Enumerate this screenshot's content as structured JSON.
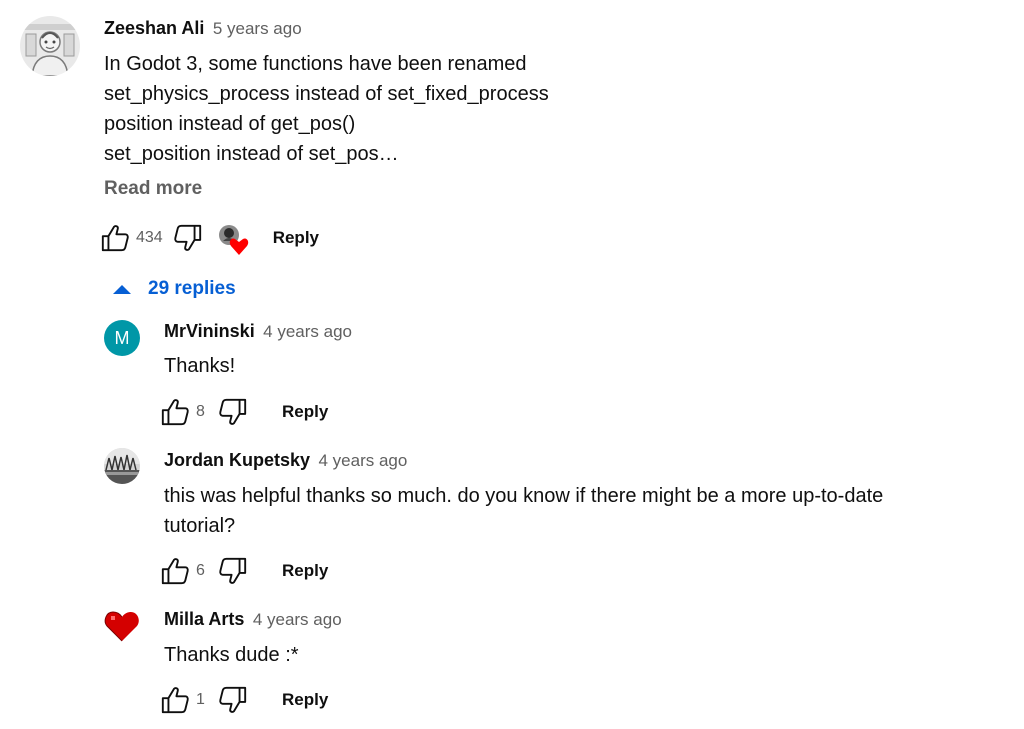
{
  "colors": {
    "link_blue": "#065fd4",
    "secondary_text": "#606060",
    "avatar_teal": "#0097a7",
    "heart_red": "#ff0000"
  },
  "top_comment": {
    "author": "Zeeshan Ali",
    "time": "5 years ago",
    "lines": [
      "In Godot 3, some functions have been renamed",
      "set_physics_process instead of set_fixed_process",
      "position instead of get_pos()",
      "set_position instead of set_pos…"
    ],
    "read_more": "Read more",
    "likes": "434",
    "reply_label": "Reply",
    "creator_heart": true
  },
  "replies_toggle": {
    "label": "29 replies"
  },
  "replies": [
    {
      "author": "MrVininski",
      "time": "4 years ago",
      "avatar_letter": "M",
      "lines": [
        "Thanks!"
      ],
      "likes": "8",
      "reply_label": "Reply"
    },
    {
      "author": "Jordan Kupetsky",
      "time": "4 years ago",
      "lines": [
        "this was helpful thanks so much. do you know if there might be a more up-to-date",
        "tutorial?"
      ],
      "likes": "6",
      "reply_label": "Reply"
    },
    {
      "author": "Milla Arts",
      "time": "4 years ago",
      "lines": [
        "Thanks dude :*"
      ],
      "likes": "1",
      "reply_label": "Reply"
    }
  ]
}
